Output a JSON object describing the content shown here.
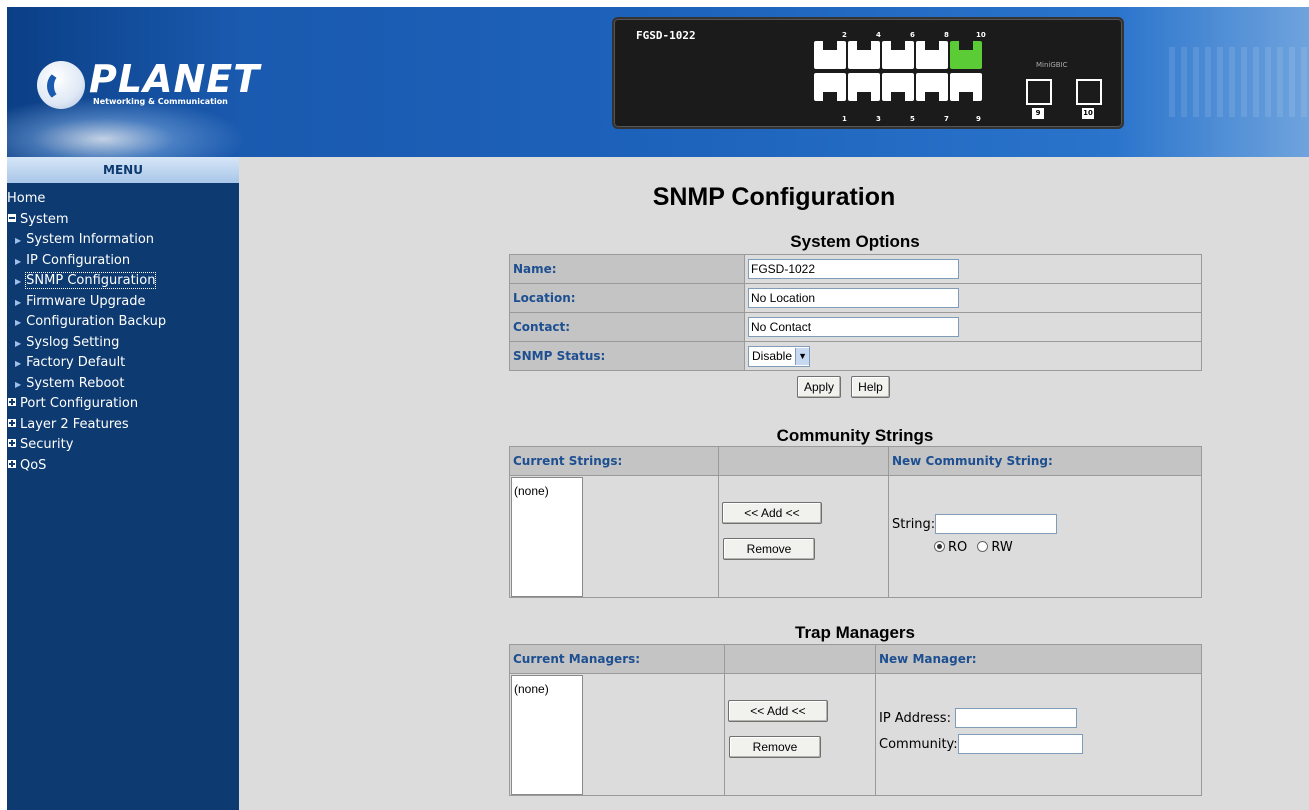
{
  "header": {
    "logo_name": "PLANET",
    "logo_tagline": "Networking & Communication",
    "device_model": "FGSD-1022",
    "top_port_numbers": [
      "2",
      "4",
      "6",
      "8",
      "10"
    ],
    "bottom_port_numbers": [
      "1",
      "3",
      "5",
      "7",
      "9"
    ],
    "mini_gbic_label": "MiniGBIC",
    "sfp_labels": [
      "9",
      "10"
    ]
  },
  "sidebar": {
    "title": "MENU",
    "items": [
      {
        "label": "Home",
        "level": 0,
        "marker": "none"
      },
      {
        "label": "System",
        "level": 0,
        "marker": "minus"
      },
      {
        "label": "System Information",
        "level": 1
      },
      {
        "label": "IP Configuration",
        "level": 1
      },
      {
        "label": "SNMP Configuration",
        "level": 1,
        "active": true
      },
      {
        "label": "Firmware Upgrade",
        "level": 1
      },
      {
        "label": "Configuration Backup",
        "level": 1
      },
      {
        "label": "Syslog Setting",
        "level": 1
      },
      {
        "label": "Factory Default",
        "level": 1
      },
      {
        "label": "System Reboot",
        "level": 1
      },
      {
        "label": "Port Configuration",
        "level": 0,
        "marker": "plus"
      },
      {
        "label": "Layer 2 Features",
        "level": 0,
        "marker": "plus"
      },
      {
        "label": "Security",
        "level": 0,
        "marker": "plus"
      },
      {
        "label": "QoS",
        "level": 0,
        "marker": "plus"
      }
    ]
  },
  "main": {
    "title": "SNMP Configuration",
    "system_options": {
      "title": "System Options",
      "name_label": "Name:",
      "name_value": "FGSD-1022",
      "location_label": "Location:",
      "location_value": "No Location",
      "contact_label": "Contact:",
      "contact_value": "No Contact",
      "status_label": "SNMP Status:",
      "status_value": "Disable",
      "apply_label": "Apply",
      "help_label": "Help"
    },
    "community": {
      "title": "Community Strings",
      "current_header": "Current Strings:",
      "new_header": "New Community String:",
      "list_items": [
        "(none)"
      ],
      "add_label": "<< Add <<",
      "remove_label": "Remove",
      "string_label": "String:",
      "string_value": "",
      "ro_label": "RO",
      "rw_label": "RW",
      "selected": "RO"
    },
    "trap": {
      "title": "Trap Managers",
      "current_header": "Current Managers:",
      "new_header": "New Manager:",
      "list_items": [
        "(none)"
      ],
      "add_label": "<< Add <<",
      "remove_label": "Remove",
      "ip_label": "IP Address:",
      "ip_value": "",
      "community_label": "Community:",
      "community_value": ""
    }
  }
}
